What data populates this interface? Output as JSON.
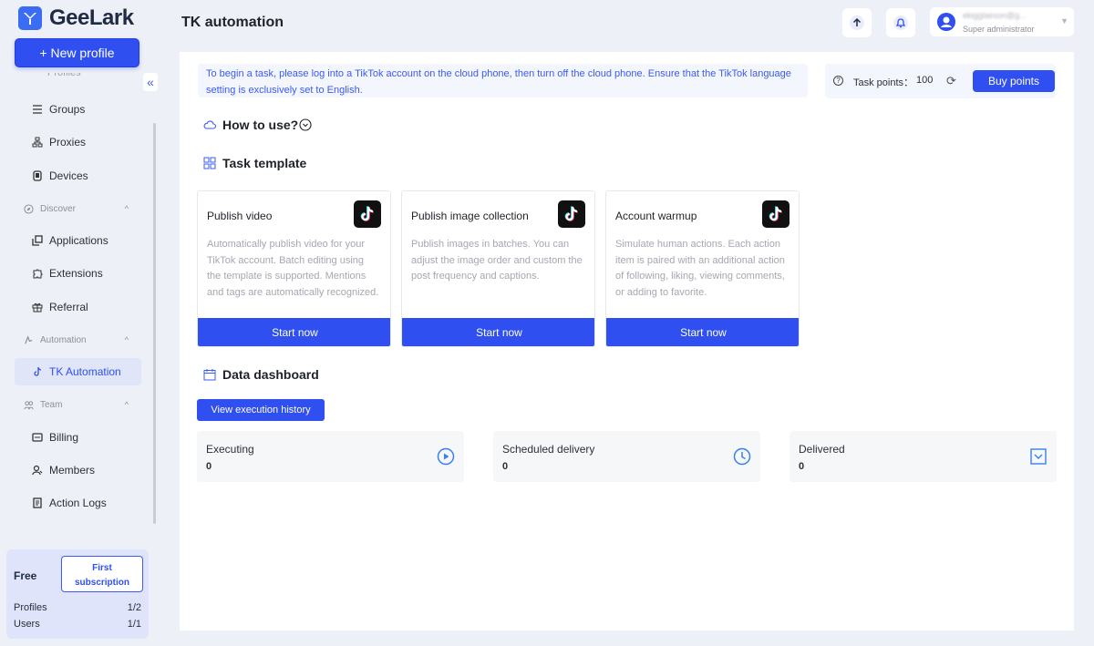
{
  "app": {
    "name": "GeeLark",
    "new_profile_label": "+ New profile",
    "collapse_glyph": "«",
    "partial_item": "Profiles"
  },
  "colors": {
    "accent": "#2f4ff0",
    "sidebar_bg": "#eef0f7",
    "notice_text": "#3a5bf0"
  },
  "sidebar": {
    "items": [
      {
        "label": "Groups",
        "icon": "list-icon"
      },
      {
        "label": "Proxies",
        "icon": "network-icon"
      },
      {
        "label": "Devices",
        "icon": "device-icon"
      },
      {
        "label": "Discover",
        "icon": "compass-icon",
        "group": true
      },
      {
        "label": "Applications",
        "icon": "apps-icon"
      },
      {
        "label": "Extensions",
        "icon": "puzzle-icon"
      },
      {
        "label": "Referral",
        "icon": "gift-icon"
      },
      {
        "label": "Automation",
        "icon": "automation-icon",
        "group": true
      },
      {
        "label": "TK Automation",
        "icon": "tiktok-icon",
        "active": true
      },
      {
        "label": "Team",
        "icon": "team-icon",
        "group": true
      },
      {
        "label": "Billing",
        "icon": "billing-icon"
      },
      {
        "label": "Members",
        "icon": "members-icon"
      },
      {
        "label": "Action Logs",
        "icon": "log-icon"
      }
    ]
  },
  "plan": {
    "name": "Free",
    "cta_line1": "First",
    "cta_line2": "subscription",
    "profiles_label": "Profiles",
    "profiles_value": "1/2",
    "users_label": "Users",
    "users_value": "1/1"
  },
  "header": {
    "title": "TK automation",
    "user_name": "ekigglaeson@g...",
    "user_role": "Super administrator"
  },
  "notice": {
    "text": "To begin a task, please log into a TikTok account on the cloud phone, then turn off the cloud phone. Ensure that the TikTok language setting is exclusively set to English."
  },
  "points": {
    "label": "Task points：",
    "value": "100",
    "buy_label": "Buy points"
  },
  "sections": {
    "how_to_use": "How to use?",
    "task_template": "Task template",
    "data_dashboard": "Data dashboard"
  },
  "templates": [
    {
      "title": "Publish video",
      "description": "Automatically publish video for your TikTok account. Batch editing using the template is supported. Mentions and tags are automatically recognized.",
      "button": "Start now"
    },
    {
      "title": "Publish image collection",
      "description": "Publish images in batches. You can adjust the image order and custom the post frequency and captions.",
      "button": "Start now"
    },
    {
      "title": "Account warmup",
      "description": "Simulate human actions. Each action item is paired with an additional action of following, liking, viewing comments, or adding to favorite.",
      "button": "Start now"
    }
  ],
  "dashboard": {
    "history_button": "View execution history",
    "stats": [
      {
        "label": "Executing",
        "value": "0",
        "icon": "play-icon"
      },
      {
        "label": "Scheduled delivery",
        "value": "0",
        "icon": "clock-icon"
      },
      {
        "label": "Delivered",
        "value": "0",
        "icon": "check-icon"
      }
    ]
  }
}
